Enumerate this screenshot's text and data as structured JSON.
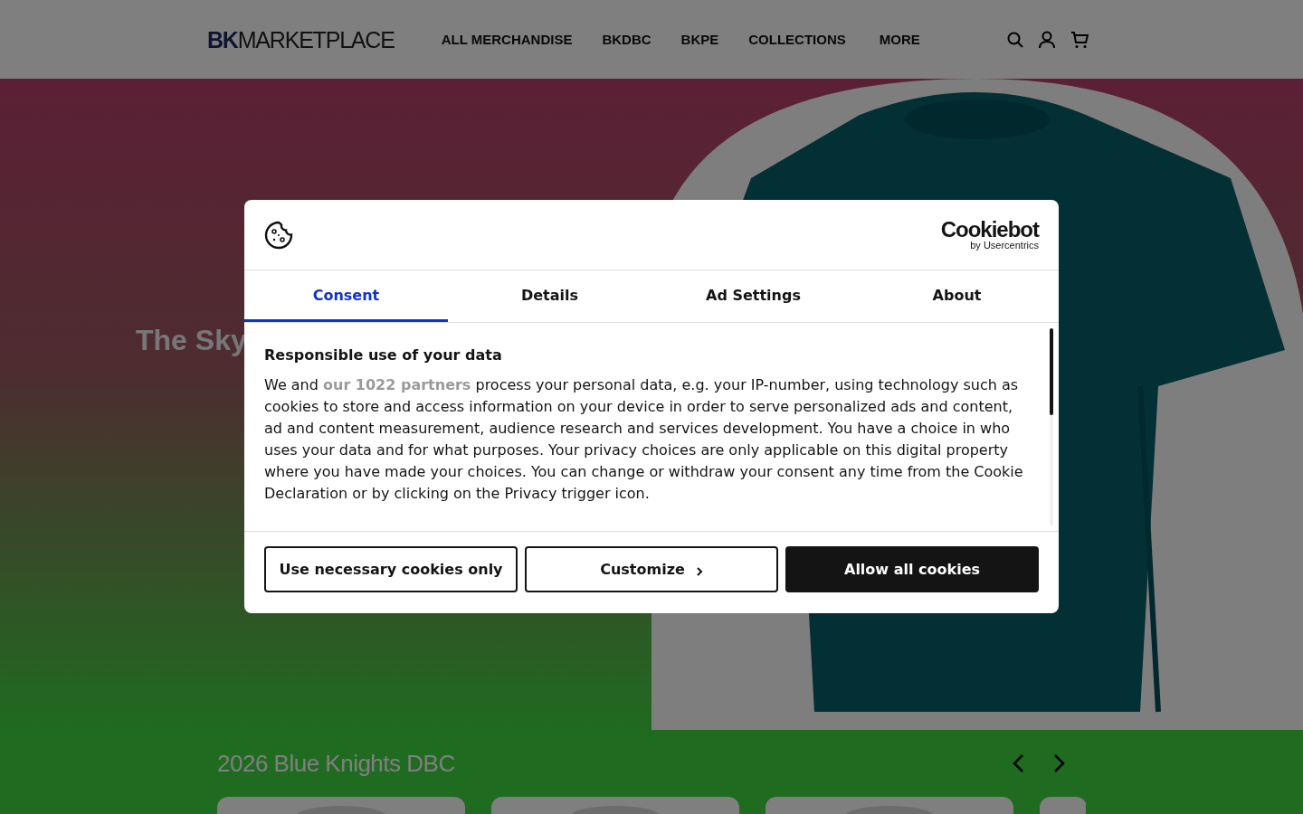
{
  "header": {
    "logo": {
      "strong": "BK",
      "rest": "MARKETPLACE"
    },
    "nav": [
      {
        "label": "ALL MERCHANDISE"
      },
      {
        "label": "BKDBC"
      },
      {
        "label": "BKPE"
      },
      {
        "label": "COLLECTIONS"
      },
      {
        "label": "MORE"
      }
    ]
  },
  "hero": {
    "title": "The Sky"
  },
  "section": {
    "title": "2026 Blue Knights DBC"
  },
  "dialog": {
    "brand": {
      "name": "Cookiebot",
      "sub": "by Usercentrics"
    },
    "tabs": [
      {
        "label": "Consent",
        "selected": true
      },
      {
        "label": "Details",
        "selected": false
      },
      {
        "label": "Ad Settings",
        "selected": false
      },
      {
        "label": "About",
        "selected": false
      }
    ],
    "heading": "Responsible use of your data",
    "body": {
      "before": "We and ",
      "link": "our 1022 partners",
      "after": " process your personal data, e.g. your IP-number, using technology such as cookies to store and access information on your device in order to serve personalized ads and content, ad and content measurement, audience research and services development. You have a choice in who uses your data and for what purposes. Your privacy choices are only applicable on this digital property where you have made your choices. You can change or withdraw your consent any time from the Cookie Declaration or by clicking on the Privacy trigger icon."
    },
    "buttons": [
      {
        "label": "Use necessary cookies only",
        "kind": "outline"
      },
      {
        "label": "Customize",
        "kind": "chevron"
      },
      {
        "label": "Allow all cookies",
        "kind": "filled"
      }
    ]
  }
}
